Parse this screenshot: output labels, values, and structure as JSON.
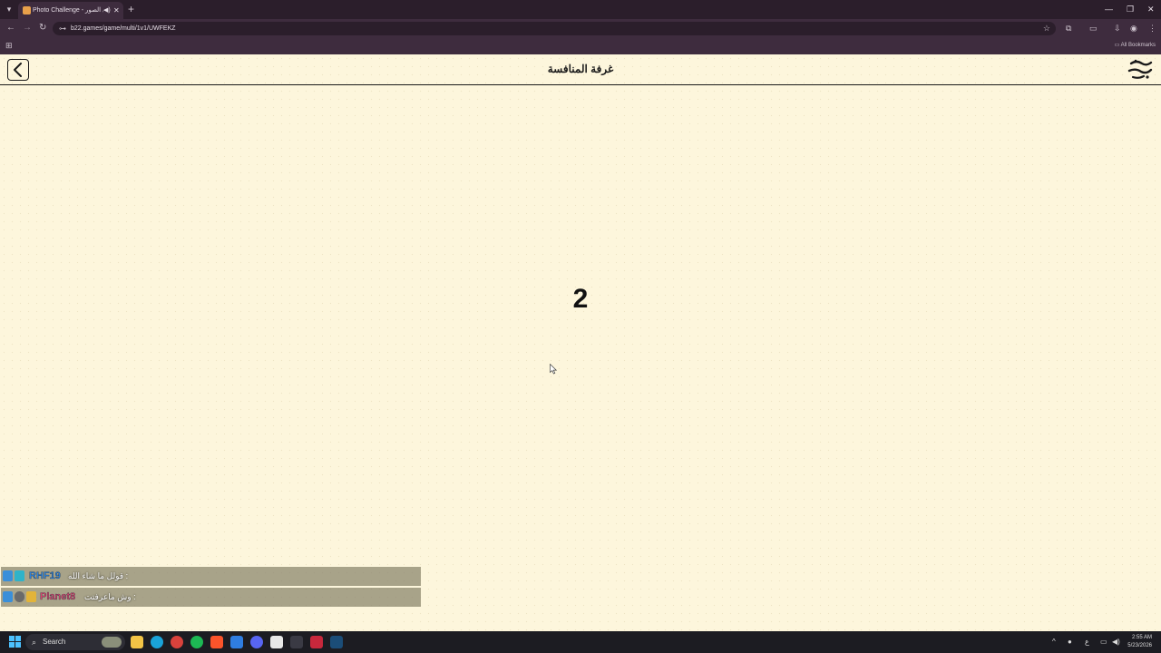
{
  "browser": {
    "tab_title": "Photo Challenge - تحدي الصور",
    "tab_audio_icon": "speaker-icon",
    "url": "b22.games/game/multi/1v1/UWFEKZ",
    "bookmarks_label": "All Bookmarks"
  },
  "header": {
    "title": "غرفة المنافسة",
    "logo_text": "تحدي الصور"
  },
  "game": {
    "countdown": "2"
  },
  "chat": [
    {
      "username": "RHF19",
      "message": ": قولل ما شاء الله",
      "color": "#2e7fd6",
      "badges": [
        "globe",
        "code"
      ]
    },
    {
      "username": "Planet8",
      "message": ": وش ماعرفتت",
      "color": "#d9436e",
      "badges": [
        "globe",
        "gear",
        "crown"
      ]
    }
  ],
  "taskbar": {
    "search_placeholder": "Search",
    "clock_time": "2:55 AM",
    "clock_date": "5/23/2026"
  }
}
